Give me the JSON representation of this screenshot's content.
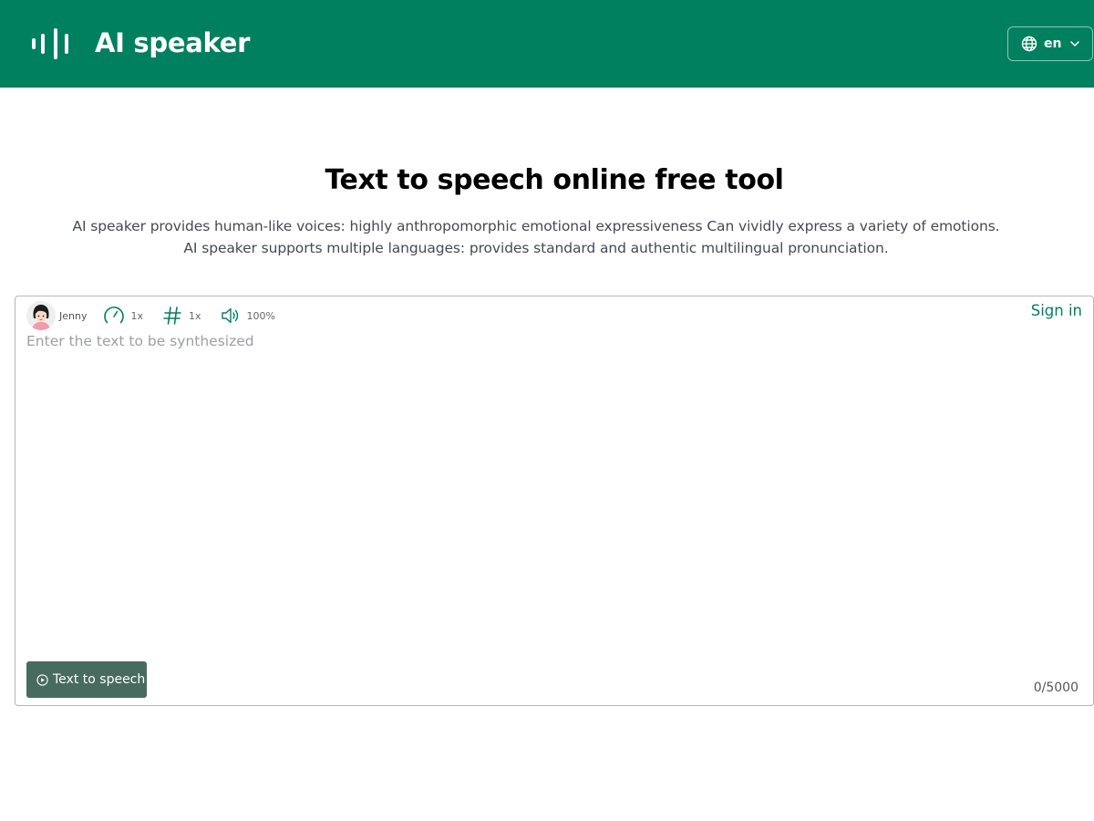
{
  "header": {
    "app_title": "AI speaker",
    "language": "en",
    "brand_color": "#00805f"
  },
  "hero": {
    "title": "Text to speech online free tool",
    "description_1": "AI speaker provides human-like voices: highly anthropomorphic emotional expressiveness Can vividly express a variety of emotions.",
    "description_2": "AI speaker supports multiple languages: provides standard and authentic multilingual pronunciation."
  },
  "editor": {
    "voice_name": "Jenny",
    "speed": "1x",
    "pitch": "1x",
    "volume": "100%",
    "sign_in": "Sign in",
    "placeholder": "Enter the text to be synthesized",
    "value": "",
    "button_label": "Text to speech",
    "char_count": "0/5000"
  },
  "icons": {
    "logo": "sound-wave-icon",
    "language": "globe-icon",
    "dropdown": "chevron-down-icon",
    "speed": "speedometer-icon",
    "pitch": "hash-icon",
    "volume": "speaker-icon",
    "play": "play-circle-icon"
  }
}
